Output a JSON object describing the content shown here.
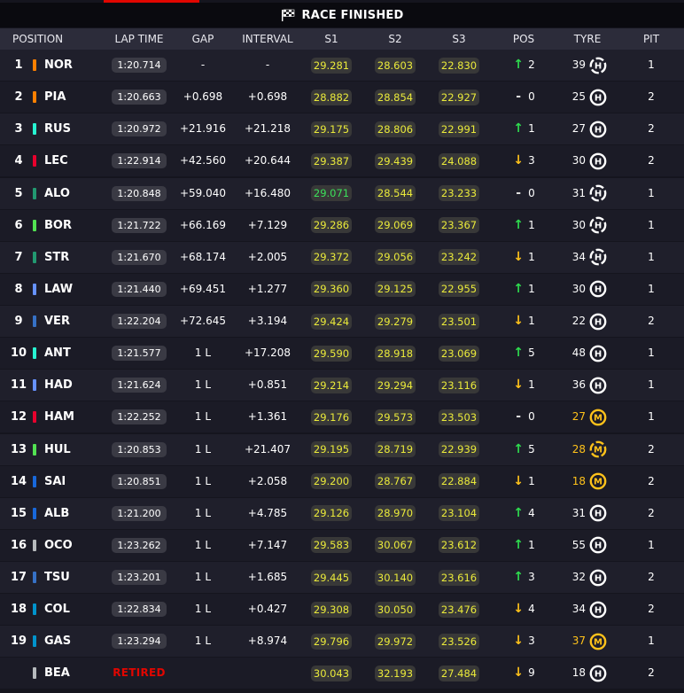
{
  "title": "RACE FINISHED",
  "headers": {
    "position": "POSITION",
    "lap_time": "LAP TIME",
    "gap": "GAP",
    "interval": "INTERVAL",
    "s1": "S1",
    "s2": "S2",
    "s3": "S3",
    "pos": "POS",
    "tyre": "TYRE",
    "pit": "PIT"
  },
  "colors": {
    "sector_yellow": "#eaea3a",
    "sector_best": "#3ce15a",
    "gain": "#2edb4e",
    "loss": "#ffc21a",
    "retired": "#e10600",
    "medium_tyre": "#ffc21a"
  },
  "rows": [
    {
      "pos": "1",
      "code": "NOR",
      "team": "#ff8000",
      "lap": "1:20.714",
      "gap": "-",
      "interval": "-",
      "s1": "29.281",
      "s2": "28.603",
      "s3": "22.830",
      "change": "up",
      "change_n": "2",
      "laps": "39",
      "tyre": "H",
      "used": true,
      "pit": "1"
    },
    {
      "pos": "2",
      "code": "PIA",
      "team": "#ff8000",
      "lap": "1:20.663",
      "gap": "+0.698",
      "interval": "+0.698",
      "s1": "28.882",
      "s2": "28.854",
      "s3": "22.927",
      "change": "same",
      "change_n": "0",
      "laps": "25",
      "tyre": "H",
      "used": false,
      "pit": "2"
    },
    {
      "pos": "3",
      "code": "RUS",
      "team": "#27f4d2",
      "lap": "1:20.972",
      "gap": "+21.916",
      "interval": "+21.218",
      "s1": "29.175",
      "s2": "28.806",
      "s3": "22.991",
      "change": "up",
      "change_n": "1",
      "laps": "27",
      "tyre": "H",
      "used": false,
      "pit": "2"
    },
    {
      "pos": "4",
      "code": "LEC",
      "team": "#e8002d",
      "lap": "1:22.914",
      "gap": "+42.560",
      "interval": "+20.644",
      "s1": "29.387",
      "s2": "29.439",
      "s3": "24.088",
      "change": "down",
      "change_n": "3",
      "laps": "30",
      "tyre": "H",
      "used": false,
      "pit": "2"
    },
    {
      "pos": "5",
      "code": "ALO",
      "team": "#229971",
      "lap": "1:20.848",
      "gap": "+59.040",
      "interval": "+16.480",
      "s1": "29.071",
      "s1_best": true,
      "s2": "28.544",
      "s3": "23.233",
      "change": "same",
      "change_n": "0",
      "laps": "31",
      "tyre": "H",
      "used": true,
      "pit": "1"
    },
    {
      "pos": "6",
      "code": "BOR",
      "team": "#52e252",
      "lap": "1:21.722",
      "gap": "+66.169",
      "interval": "+7.129",
      "s1": "29.286",
      "s2": "29.069",
      "s3": "23.367",
      "change": "up",
      "change_n": "1",
      "laps": "30",
      "tyre": "H",
      "used": true,
      "pit": "1"
    },
    {
      "pos": "7",
      "code": "STR",
      "team": "#229971",
      "lap": "1:21.670",
      "gap": "+68.174",
      "interval": "+2.005",
      "s1": "29.372",
      "s2": "29.056",
      "s3": "23.242",
      "change": "down",
      "change_n": "1",
      "laps": "34",
      "tyre": "H",
      "used": true,
      "pit": "1"
    },
    {
      "pos": "8",
      "code": "LAW",
      "team": "#6692ff",
      "lap": "1:21.440",
      "gap": "+69.451",
      "interval": "+1.277",
      "s1": "29.360",
      "s2": "29.125",
      "s3": "22.955",
      "change": "up",
      "change_n": "1",
      "laps": "30",
      "tyre": "H",
      "used": false,
      "pit": "1"
    },
    {
      "pos": "9",
      "code": "VER",
      "team": "#3671c6",
      "lap": "1:22.204",
      "gap": "+72.645",
      "interval": "+3.194",
      "s1": "29.424",
      "s2": "29.279",
      "s3": "23.501",
      "change": "down",
      "change_n": "1",
      "laps": "22",
      "tyre": "H",
      "used": false,
      "pit": "2"
    },
    {
      "pos": "10",
      "code": "ANT",
      "team": "#27f4d2",
      "lap": "1:21.577",
      "gap": "1 L",
      "interval": "+17.208",
      "s1": "29.590",
      "s2": "28.918",
      "s3": "23.069",
      "change": "up",
      "change_n": "5",
      "laps": "48",
      "tyre": "H",
      "used": false,
      "pit": "1"
    },
    {
      "pos": "11",
      "code": "HAD",
      "team": "#6692ff",
      "lap": "1:21.624",
      "gap": "1 L",
      "interval": "+0.851",
      "s1": "29.214",
      "s2": "29.294",
      "s3": "23.116",
      "change": "down",
      "change_n": "1",
      "laps": "36",
      "tyre": "H",
      "used": false,
      "pit": "1"
    },
    {
      "pos": "12",
      "code": "HAM",
      "team": "#e8002d",
      "lap": "1:22.252",
      "gap": "1 L",
      "interval": "+1.361",
      "s1": "29.176",
      "s2": "29.573",
      "s3": "23.503",
      "change": "same",
      "change_n": "0",
      "laps": "27",
      "tyre": "M",
      "used": false,
      "pit": "1"
    },
    {
      "pos": "13",
      "code": "HUL",
      "team": "#52e252",
      "lap": "1:20.853",
      "gap": "1 L",
      "interval": "+21.407",
      "s1": "29.195",
      "s2": "28.719",
      "s3": "22.939",
      "change": "up",
      "change_n": "5",
      "laps": "28",
      "tyre": "M",
      "used": true,
      "pit": "2"
    },
    {
      "pos": "14",
      "code": "SAI",
      "team": "#1868db",
      "lap": "1:20.851",
      "gap": "1 L",
      "interval": "+2.058",
      "s1": "29.200",
      "s2": "28.767",
      "s3": "22.884",
      "change": "down",
      "change_n": "1",
      "laps": "18",
      "tyre": "M",
      "used": false,
      "pit": "2"
    },
    {
      "pos": "15",
      "code": "ALB",
      "team": "#1868db",
      "lap": "1:21.200",
      "gap": "1 L",
      "interval": "+4.785",
      "s1": "29.126",
      "s2": "28.970",
      "s3": "23.104",
      "change": "up",
      "change_n": "4",
      "laps": "31",
      "tyre": "H",
      "used": false,
      "pit": "2"
    },
    {
      "pos": "16",
      "code": "OCO",
      "team": "#b6babd",
      "lap": "1:23.262",
      "gap": "1 L",
      "interval": "+7.147",
      "s1": "29.583",
      "s2": "30.067",
      "s3": "23.612",
      "change": "up",
      "change_n": "1",
      "laps": "55",
      "tyre": "H",
      "used": false,
      "pit": "1"
    },
    {
      "pos": "17",
      "code": "TSU",
      "team": "#3671c6",
      "lap": "1:23.201",
      "gap": "1 L",
      "interval": "+1.685",
      "s1": "29.445",
      "s2": "30.140",
      "s3": "23.616",
      "change": "up",
      "change_n": "3",
      "laps": "32",
      "tyre": "H",
      "used": false,
      "pit": "2"
    },
    {
      "pos": "18",
      "code": "COL",
      "team": "#0093cc",
      "lap": "1:22.834",
      "gap": "1 L",
      "interval": "+0.427",
      "s1": "29.308",
      "s2": "30.050",
      "s3": "23.476",
      "change": "down",
      "change_n": "4",
      "laps": "34",
      "tyre": "H",
      "used": false,
      "pit": "2"
    },
    {
      "pos": "19",
      "code": "GAS",
      "team": "#0093cc",
      "lap": "1:23.294",
      "gap": "1 L",
      "interval": "+8.974",
      "s1": "29.796",
      "s2": "29.972",
      "s3": "23.526",
      "change": "down",
      "change_n": "3",
      "laps": "37",
      "tyre": "M",
      "used": false,
      "pit": "1"
    },
    {
      "pos": "",
      "code": "BEA",
      "team": "#b6babd",
      "lap": "",
      "retired": "RETIRED",
      "gap": "",
      "interval": "",
      "s1": "30.043",
      "s2": "32.193",
      "s3": "27.484",
      "change": "down",
      "change_n": "9",
      "laps": "18",
      "tyre": "H",
      "used": false,
      "pit": "2"
    }
  ]
}
